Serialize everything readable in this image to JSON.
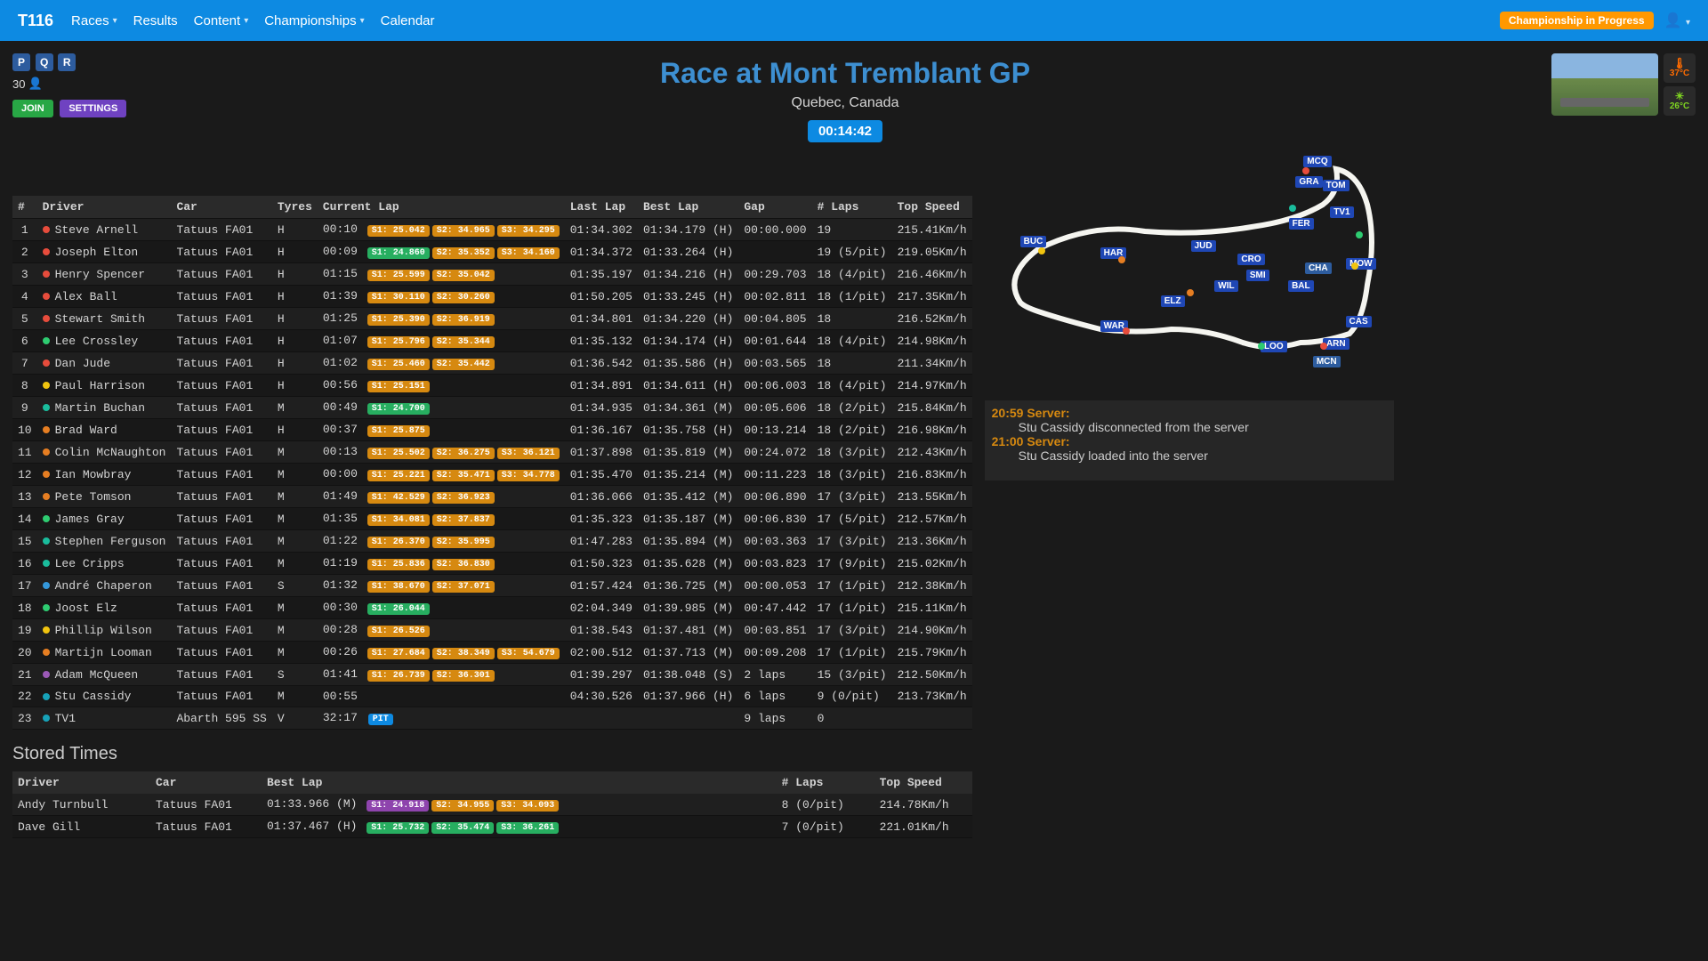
{
  "nav": {
    "brand": "T116",
    "items": [
      "Races",
      "Results",
      "Content",
      "Championships",
      "Calendar"
    ],
    "badge": "Championship in Progress"
  },
  "session_badges": {
    "p": "P",
    "q": "Q",
    "r": "R"
  },
  "driver_count": "30",
  "buttons": {
    "join": "JOIN",
    "settings": "SETTINGS"
  },
  "title": "Race at Mont Tremblant GP",
  "location": "Quebec, Canada",
  "clock": "00:14:42",
  "weather": {
    "track": "37°C",
    "ambient": "26°C"
  },
  "columns": {
    "pos": "#",
    "driver": "Driver",
    "car": "Car",
    "tyres": "Tyres",
    "curlap": "Current Lap",
    "last": "Last Lap",
    "best": "Best Lap",
    "gap": "Gap",
    "laps": "# Laps",
    "top": "Top Speed"
  },
  "rows": [
    {
      "pos": "1",
      "dot": "red",
      "driver": "Steve Arnell",
      "car": "Tatuus FA01",
      "tyres": "H",
      "cur": "00:10",
      "sectors": [
        {
          "t": "S1: 25.042",
          "c": "orange"
        },
        {
          "t": "S2: 34.965",
          "c": "orange"
        },
        {
          "t": "S3: 34.295",
          "c": "orange"
        }
      ],
      "last": "01:34.302",
      "best": "01:34.179 (H)",
      "gap": "00:00.000",
      "laps": "19",
      "top": "215.41Km/h"
    },
    {
      "pos": "2",
      "dot": "red",
      "driver": "Joseph Elton",
      "car": "Tatuus FA01",
      "tyres": "H",
      "cur": "00:09",
      "sectors": [
        {
          "t": "S1: 24.860",
          "c": "green"
        },
        {
          "t": "S2: 35.352",
          "c": "orange"
        },
        {
          "t": "S3: 34.160",
          "c": "orange"
        }
      ],
      "last": "01:34.372",
      "best": "01:33.264 (H)",
      "gap": "",
      "laps": "19 (5/pit)",
      "top": "219.05Km/h"
    },
    {
      "pos": "3",
      "dot": "red",
      "driver": "Henry Spencer",
      "car": "Tatuus FA01",
      "tyres": "H",
      "cur": "01:15",
      "sectors": [
        {
          "t": "S1: 25.599",
          "c": "orange"
        },
        {
          "t": "S2: 35.042",
          "c": "orange"
        }
      ],
      "last": "01:35.197",
      "best": "01:34.216 (H)",
      "gap": "00:29.703",
      "laps": "18 (4/pit)",
      "top": "216.46Km/h"
    },
    {
      "pos": "4",
      "dot": "red",
      "driver": "Alex Ball",
      "car": "Tatuus FA01",
      "tyres": "H",
      "cur": "01:39",
      "sectors": [
        {
          "t": "S1: 30.110",
          "c": "orange"
        },
        {
          "t": "S2: 30.260",
          "c": "orange"
        }
      ],
      "last": "01:50.205",
      "best": "01:33.245 (H)",
      "gap": "00:02.811",
      "laps": "18 (1/pit)",
      "top": "217.35Km/h"
    },
    {
      "pos": "5",
      "dot": "red",
      "driver": "Stewart Smith",
      "car": "Tatuus FA01",
      "tyres": "H",
      "cur": "01:25",
      "sectors": [
        {
          "t": "S1: 25.390",
          "c": "orange"
        },
        {
          "t": "S2: 36.919",
          "c": "orange"
        }
      ],
      "last": "01:34.801",
      "best": "01:34.220 (H)",
      "gap": "00:04.805",
      "laps": "18",
      "top": "216.52Km/h"
    },
    {
      "pos": "6",
      "dot": "green",
      "driver": "Lee Crossley",
      "car": "Tatuus FA01",
      "tyres": "H",
      "cur": "01:07",
      "sectors": [
        {
          "t": "S1: 25.796",
          "c": "orange"
        },
        {
          "t": "S2: 35.344",
          "c": "orange"
        }
      ],
      "last": "01:35.132",
      "best": "01:34.174 (H)",
      "gap": "00:01.644",
      "laps": "18 (4/pit)",
      "top": "214.98Km/h"
    },
    {
      "pos": "7",
      "dot": "red",
      "driver": "Dan Jude",
      "car": "Tatuus FA01",
      "tyres": "H",
      "cur": "01:02",
      "sectors": [
        {
          "t": "S1: 25.460",
          "c": "orange"
        },
        {
          "t": "S2: 35.442",
          "c": "orange"
        }
      ],
      "last": "01:36.542",
      "best": "01:35.586 (H)",
      "gap": "00:03.565",
      "laps": "18",
      "top": "211.34Km/h"
    },
    {
      "pos": "8",
      "dot": "yellow",
      "driver": "Paul Harrison",
      "car": "Tatuus FA01",
      "tyres": "H",
      "cur": "00:56",
      "sectors": [
        {
          "t": "S1: 25.151",
          "c": "orange"
        }
      ],
      "last": "01:34.891",
      "best": "01:34.611 (H)",
      "gap": "00:06.003",
      "laps": "18 (4/pit)",
      "top": "214.97Km/h"
    },
    {
      "pos": "9",
      "dot": "cyan",
      "driver": "Martin Buchan",
      "car": "Tatuus FA01",
      "tyres": "M",
      "cur": "00:49",
      "sectors": [
        {
          "t": "S1: 24.700",
          "c": "green"
        }
      ],
      "last": "01:34.935",
      "best": "01:34.361 (M)",
      "gap": "00:05.606",
      "laps": "18 (2/pit)",
      "top": "215.84Km/h"
    },
    {
      "pos": "10",
      "dot": "orange",
      "driver": "Brad Ward",
      "car": "Tatuus FA01",
      "tyres": "H",
      "cur": "00:37",
      "sectors": [
        {
          "t": "S1: 25.875",
          "c": "orange"
        }
      ],
      "last": "01:36.167",
      "best": "01:35.758 (H)",
      "gap": "00:13.214",
      "laps": "18 (2/pit)",
      "top": "216.98Km/h"
    },
    {
      "pos": "11",
      "dot": "orange",
      "driver": "Colin McNaughton",
      "car": "Tatuus FA01",
      "tyres": "M",
      "cur": "00:13",
      "sectors": [
        {
          "t": "S1: 25.502",
          "c": "orange"
        },
        {
          "t": "S2: 36.275",
          "c": "orange"
        },
        {
          "t": "S3: 36.121",
          "c": "orange"
        }
      ],
      "last": "01:37.898",
      "best": "01:35.819 (M)",
      "gap": "00:24.072",
      "laps": "18 (3/pit)",
      "top": "212.43Km/h"
    },
    {
      "pos": "12",
      "dot": "orange",
      "driver": "Ian Mowbray",
      "car": "Tatuus FA01",
      "tyres": "M",
      "cur": "00:00",
      "sectors": [
        {
          "t": "S1: 25.221",
          "c": "orange"
        },
        {
          "t": "S2: 35.471",
          "c": "orange"
        },
        {
          "t": "S3: 34.778",
          "c": "orange"
        }
      ],
      "last": "01:35.470",
      "best": "01:35.214 (M)",
      "gap": "00:11.223",
      "laps": "18 (3/pit)",
      "top": "216.83Km/h"
    },
    {
      "pos": "13",
      "dot": "orange",
      "driver": "Pete Tomson",
      "car": "Tatuus FA01",
      "tyres": "M",
      "cur": "01:49",
      "sectors": [
        {
          "t": "S1: 42.529",
          "c": "orange"
        },
        {
          "t": "S2: 36.923",
          "c": "orange"
        }
      ],
      "last": "01:36.066",
      "best": "01:35.412 (M)",
      "gap": "00:06.890",
      "laps": "17 (3/pit)",
      "top": "213.55Km/h"
    },
    {
      "pos": "14",
      "dot": "green",
      "driver": "James Gray",
      "car": "Tatuus FA01",
      "tyres": "M",
      "cur": "01:35",
      "sectors": [
        {
          "t": "S1: 34.081",
          "c": "orange"
        },
        {
          "t": "S2: 37.837",
          "c": "orange"
        }
      ],
      "last": "01:35.323",
      "best": "01:35.187 (M)",
      "gap": "00:06.830",
      "laps": "17 (5/pit)",
      "top": "212.57Km/h"
    },
    {
      "pos": "15",
      "dot": "cyan",
      "driver": "Stephen Ferguson",
      "car": "Tatuus FA01",
      "tyres": "M",
      "cur": "01:22",
      "sectors": [
        {
          "t": "S1: 26.370",
          "c": "orange"
        },
        {
          "t": "S2: 35.995",
          "c": "orange"
        }
      ],
      "last": "01:47.283",
      "best": "01:35.894 (M)",
      "gap": "00:03.363",
      "laps": "17 (3/pit)",
      "top": "213.36Km/h"
    },
    {
      "pos": "16",
      "dot": "cyan",
      "driver": "Lee Cripps",
      "car": "Tatuus FA01",
      "tyres": "M",
      "cur": "01:19",
      "sectors": [
        {
          "t": "S1: 25.836",
          "c": "orange"
        },
        {
          "t": "S2: 36.830",
          "c": "orange"
        }
      ],
      "last": "01:50.323",
      "best": "01:35.628 (M)",
      "gap": "00:03.823",
      "laps": "17 (9/pit)",
      "top": "215.02Km/h"
    },
    {
      "pos": "17",
      "dot": "blue",
      "driver": "André Chaperon",
      "car": "Tatuus FA01",
      "tyres": "S",
      "cur": "01:32",
      "sectors": [
        {
          "t": "S1: 38.670",
          "c": "orange"
        },
        {
          "t": "S2: 37.071",
          "c": "orange"
        }
      ],
      "last": "01:57.424",
      "best": "01:36.725 (M)",
      "gap": "00:00.053",
      "laps": "17 (1/pit)",
      "top": "212.38Km/h"
    },
    {
      "pos": "18",
      "dot": "green",
      "driver": "Joost Elz",
      "car": "Tatuus FA01",
      "tyres": "M",
      "cur": "00:30",
      "sectors": [
        {
          "t": "S1: 26.044",
          "c": "green"
        }
      ],
      "last": "02:04.349",
      "best": "01:39.985 (M)",
      "gap": "00:47.442",
      "laps": "17 (1/pit)",
      "top": "215.11Km/h"
    },
    {
      "pos": "19",
      "dot": "yellow",
      "driver": "Phillip Wilson",
      "car": "Tatuus FA01",
      "tyres": "M",
      "cur": "00:28",
      "sectors": [
        {
          "t": "S1: 26.526",
          "c": "orange"
        }
      ],
      "last": "01:38.543",
      "best": "01:37.481 (M)",
      "gap": "00:03.851",
      "laps": "17 (3/pit)",
      "top": "214.90Km/h"
    },
    {
      "pos": "20",
      "dot": "orange",
      "driver": "Martijn Looman",
      "car": "Tatuus FA01",
      "tyres": "M",
      "cur": "00:26",
      "sectors": [
        {
          "t": "S1: 27.684",
          "c": "orange"
        },
        {
          "t": "S2: 38.349",
          "c": "orange"
        },
        {
          "t": "S3: 54.679",
          "c": "orange"
        }
      ],
      "last": "02:00.512",
      "best": "01:37.713 (M)",
      "gap": "00:09.208",
      "laps": "17 (1/pit)",
      "top": "215.79Km/h"
    },
    {
      "pos": "21",
      "dot": "purple",
      "driver": "Adam McQueen",
      "car": "Tatuus FA01",
      "tyres": "S",
      "cur": "01:41",
      "sectors": [
        {
          "t": "S1: 26.739",
          "c": "orange"
        },
        {
          "t": "S2: 36.301",
          "c": "orange"
        }
      ],
      "last": "01:39.297",
      "best": "01:38.048 (S)",
      "gap": "2 laps",
      "laps": "15 (3/pit)",
      "top": "212.50Km/h"
    },
    {
      "pos": "22",
      "dot": "teal",
      "driver": "Stu Cassidy",
      "car": "Tatuus FA01",
      "tyres": "M",
      "cur": "00:55",
      "sectors": [],
      "last": "04:30.526",
      "best": "01:37.966 (H)",
      "gap": "6 laps",
      "laps": "9 (0/pit)",
      "top": "213.73Km/h"
    },
    {
      "pos": "23",
      "dot": "teal",
      "driver": "TV1",
      "car": "Abarth 595 SS",
      "tyres": "V",
      "cur": "32:17",
      "pit": "PIT",
      "sectors": [],
      "last": "",
      "best": "",
      "gap": "9 laps",
      "laps": "0",
      "top": ""
    }
  ],
  "stored_title": "Stored Times",
  "stored_columns": {
    "driver": "Driver",
    "car": "Car",
    "best": "Best Lap",
    "laps": "# Laps",
    "top": "Top Speed"
  },
  "stored_rows": [
    {
      "driver": "Andy Turnbull",
      "car": "Tatuus FA01",
      "best": "01:33.966 (M)",
      "sectors": [
        {
          "t": "S1: 24.918",
          "c": "purple"
        },
        {
          "t": "S2: 34.955",
          "c": "orange"
        },
        {
          "t": "S3: 34.093",
          "c": "orange"
        }
      ],
      "laps": "8 (0/pit)",
      "top": "214.78Km/h"
    },
    {
      "driver": "Dave Gill",
      "car": "Tatuus FA01",
      "best": "01:37.467 (H)",
      "sectors": [
        {
          "t": "S1: 25.732",
          "c": "green"
        },
        {
          "t": "S2: 35.474",
          "c": "green"
        },
        {
          "t": "S3: 36.261",
          "c": "green"
        }
      ],
      "laps": "7 (0/pit)",
      "top": "221.01Km/h"
    }
  ],
  "map_labels": [
    "MCQ",
    "GRA",
    "TOM",
    "TV1",
    "FER",
    "CHA",
    "MOW",
    "CRO",
    "SMI",
    "JUD",
    "BAL",
    "WIL",
    "ELZ",
    "HAR",
    "BUC",
    "WAR",
    "CAS",
    "LOO",
    "ARN",
    "MCN"
  ],
  "chat": [
    {
      "time": "20:59 Server:",
      "msg": "Stu Cassidy disconnected from the server"
    },
    {
      "time": "21:00 Server:",
      "msg": "Stu Cassidy loaded into the server"
    }
  ]
}
